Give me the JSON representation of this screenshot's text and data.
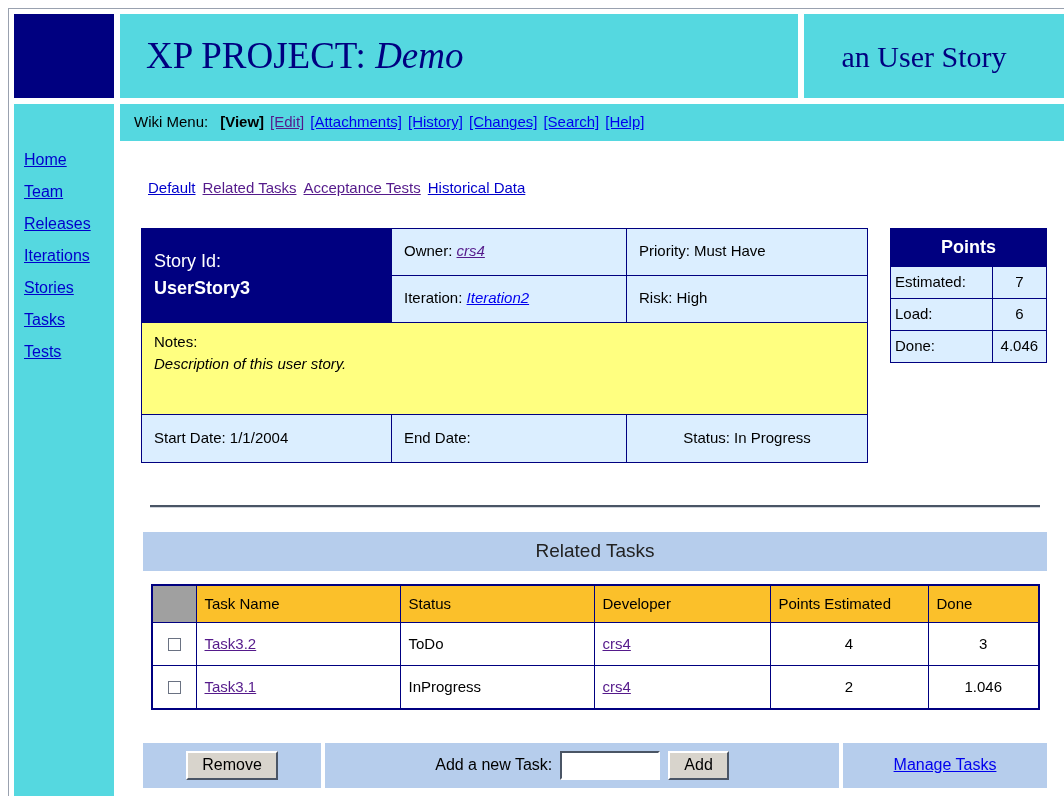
{
  "header": {
    "title": "XP PROJECT:",
    "project": "Demo",
    "page_kind": "an User Story"
  },
  "wiki_menu": {
    "label": "Wiki Menu:",
    "items": [
      {
        "label": "[View]",
        "selected": true
      },
      {
        "label": "[Edit]",
        "selected": false,
        "visited": true
      },
      {
        "label": "[Attachments]",
        "selected": false,
        "visited": false
      },
      {
        "label": "[History]",
        "selected": false,
        "visited": false
      },
      {
        "label": "[Changes]",
        "selected": false,
        "visited": false
      },
      {
        "label": "[Search]",
        "selected": false,
        "visited": false
      },
      {
        "label": "[Help]",
        "selected": false,
        "visited": false
      }
    ]
  },
  "sidebar": {
    "items": [
      "Home",
      "Team",
      "Releases",
      "Iterations",
      "Stories",
      "Tasks",
      "Tests"
    ]
  },
  "views": [
    {
      "label": "Default",
      "visited": false
    },
    {
      "label": "Related Tasks",
      "visited": true
    },
    {
      "label": "Acceptance Tests",
      "visited": true
    },
    {
      "label": "Historical Data",
      "visited": false
    }
  ],
  "story": {
    "id_label": "Story Id:",
    "id": "UserStory3",
    "owner_label": "Owner:",
    "owner": "crs4",
    "iteration_label": "Iteration:",
    "iteration": "Iteration2",
    "priority": "Priority: Must Have",
    "risk": "Risk: High",
    "notes_label": "Notes:",
    "notes": "Description of this user story.",
    "start_date": "Start Date: 1/1/2004",
    "end_date": "End Date:",
    "status": "Status: In Progress"
  },
  "points": {
    "title": "Points",
    "rows": [
      {
        "label": "Estimated:",
        "value": "7"
      },
      {
        "label": "Load:",
        "value": "6"
      },
      {
        "label": "Done:",
        "value": "4.046"
      }
    ]
  },
  "related_tasks": {
    "title": "Related Tasks",
    "columns": [
      "Task Name",
      "Status",
      "Developer",
      "Points Estimated",
      "Done"
    ],
    "rows": [
      {
        "checked": false,
        "name": "Task3.2",
        "status": "ToDo",
        "developer": "crs4",
        "points_estimated": "4",
        "done": "3"
      },
      {
        "checked": false,
        "name": "Task3.1",
        "status": "InProgress",
        "developer": "crs4",
        "points_estimated": "2",
        "done": "1.046"
      }
    ]
  },
  "actions": {
    "remove": "Remove",
    "add_label": "Add a new Task:",
    "add": "Add",
    "manage": "Manage Tasks"
  }
}
